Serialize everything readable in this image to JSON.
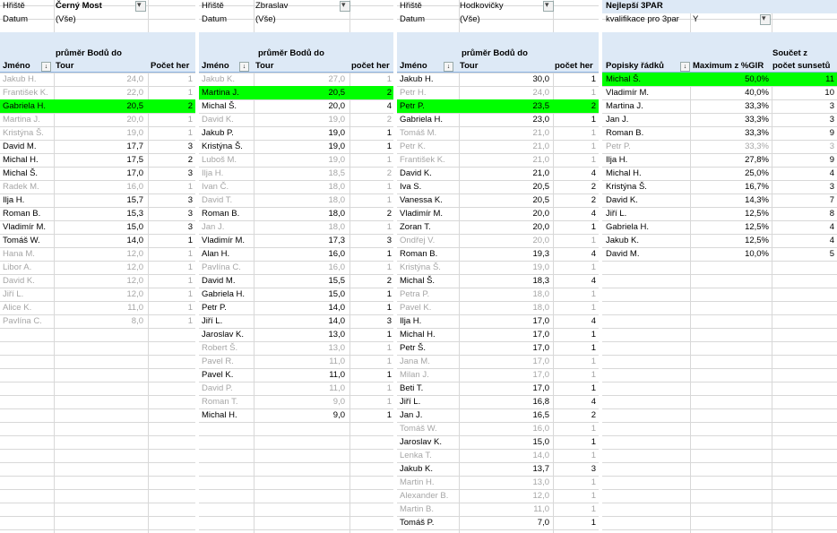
{
  "panels": [
    {
      "filter1_label": "Hřiště",
      "filter1_value": "Černý Most",
      "filter2_label": "Datum",
      "filter2_value": "(Vše)",
      "header": {
        "line1": "průměr Bodů do",
        "name": "Jméno",
        "avg": "Tour",
        "count": "Počet her"
      },
      "rows": [
        {
          "name": "Jakub H.",
          "avg": "24,0",
          "count": "1",
          "dim": true
        },
        {
          "name": "František K.",
          "avg": "22,0",
          "count": "1",
          "dim": true
        },
        {
          "name": "Gabriela H.",
          "avg": "20,5",
          "count": "2",
          "hl": true
        },
        {
          "name": "Martina J.",
          "avg": "20,0",
          "count": "1",
          "dim": true
        },
        {
          "name": "Kristýna Š.",
          "avg": "19,0",
          "count": "1",
          "dim": true
        },
        {
          "name": "David M.",
          "avg": "17,7",
          "count": "3"
        },
        {
          "name": "Michal H.",
          "avg": "17,5",
          "count": "2"
        },
        {
          "name": "Michal Š.",
          "avg": "17,0",
          "count": "3"
        },
        {
          "name": "Radek M.",
          "avg": "16,0",
          "count": "1",
          "dim": true
        },
        {
          "name": "Ilja H.",
          "avg": "15,7",
          "count": "3"
        },
        {
          "name": "Roman B.",
          "avg": "15,3",
          "count": "3"
        },
        {
          "name": "Vladimír M.",
          "avg": "15,0",
          "count": "3"
        },
        {
          "name": "Tomáš W.",
          "avg": "14,0",
          "count": "1"
        },
        {
          "name": "Hana M.",
          "avg": "12,0",
          "count": "1",
          "dim": true
        },
        {
          "name": "Libor A.",
          "avg": "12,0",
          "count": "1",
          "dim": true
        },
        {
          "name": "David K.",
          "avg": "12,0",
          "count": "1",
          "dim": true
        },
        {
          "name": "Jiří L.",
          "avg": "12,0",
          "count": "1",
          "dim": true
        },
        {
          "name": "Alice K.",
          "avg": "11,0",
          "count": "1",
          "dim": true
        },
        {
          "name": "Pavlína C.",
          "avg": "8,0",
          "count": "1",
          "dim": true
        }
      ]
    },
    {
      "filter1_label": "Hřiště",
      "filter1_value": "Zbraslav",
      "filter2_label": "Datum",
      "filter2_value": "(Vše)",
      "header": {
        "line1": "průměr Bodů do",
        "name": "Jméno",
        "avg": "Tour",
        "count": "počet her"
      },
      "rows": [
        {
          "name": "Jakub K.",
          "avg": "27,0",
          "count": "1",
          "dim": true
        },
        {
          "name": "Martina J.",
          "avg": "20,5",
          "count": "2",
          "hl": true
        },
        {
          "name": "Michal Š.",
          "avg": "20,0",
          "count": "4"
        },
        {
          "name": "David K.",
          "avg": "19,0",
          "count": "2",
          "dim": true
        },
        {
          "name": "Jakub P.",
          "avg": "19,0",
          "count": "1"
        },
        {
          "name": "Kristýna Š.",
          "avg": "19,0",
          "count": "1"
        },
        {
          "name": "Luboš M.",
          "avg": "19,0",
          "count": "1",
          "dim": true
        },
        {
          "name": "Ilja H.",
          "avg": "18,5",
          "count": "2",
          "dim": true
        },
        {
          "name": "Ivan Č.",
          "avg": "18,0",
          "count": "1",
          "dim": true
        },
        {
          "name": "David T.",
          "avg": "18,0",
          "count": "1",
          "dim": true
        },
        {
          "name": "Roman B.",
          "avg": "18,0",
          "count": "2"
        },
        {
          "name": "Jan J.",
          "avg": "18,0",
          "count": "1",
          "dim": true
        },
        {
          "name": "Vladimír M.",
          "avg": "17,3",
          "count": "3"
        },
        {
          "name": "Alan H.",
          "avg": "16,0",
          "count": "1"
        },
        {
          "name": "Pavlína C.",
          "avg": "16,0",
          "count": "1",
          "dim": true
        },
        {
          "name": "David M.",
          "avg": "15,5",
          "count": "2"
        },
        {
          "name": "Gabriela H.",
          "avg": "15,0",
          "count": "1"
        },
        {
          "name": "Petr P.",
          "avg": "14,0",
          "count": "1"
        },
        {
          "name": "Jiří L.",
          "avg": "14,0",
          "count": "3"
        },
        {
          "name": "Jaroslav K.",
          "avg": "13,0",
          "count": "1"
        },
        {
          "name": "Robert Š.",
          "avg": "13,0",
          "count": "1",
          "dim": true
        },
        {
          "name": "Pavel R.",
          "avg": "11,0",
          "count": "1",
          "dim": true
        },
        {
          "name": "Pavel K.",
          "avg": "11,0",
          "count": "1"
        },
        {
          "name": "David P.",
          "avg": "11,0",
          "count": "1",
          "dim": true
        },
        {
          "name": "Roman T.",
          "avg": "9,0",
          "count": "1",
          "dim": true
        },
        {
          "name": "Michal H.",
          "avg": "9,0",
          "count": "1"
        }
      ]
    },
    {
      "filter1_label": "Hřiště",
      "filter1_value": "Hodkovičky",
      "filter2_label": "Datum",
      "filter2_value": "(Vše)",
      "header": {
        "line1": "průměr Bodů do",
        "name": "Jméno",
        "avg": "Tour",
        "count": "počet her"
      },
      "rows": [
        {
          "name": "Jakub H.",
          "avg": "30,0",
          "count": "1"
        },
        {
          "name": "Petr H.",
          "avg": "24,0",
          "count": "1",
          "dim": true
        },
        {
          "name": "Petr P.",
          "avg": "23,5",
          "count": "2",
          "hl": true
        },
        {
          "name": "Gabriela H.",
          "avg": "23,0",
          "count": "1"
        },
        {
          "name": "Tomáš M.",
          "avg": "21,0",
          "count": "1",
          "dim": true
        },
        {
          "name": "Petr K.",
          "avg": "21,0",
          "count": "1",
          "dim": true
        },
        {
          "name": "František K.",
          "avg": "21,0",
          "count": "1",
          "dim": true
        },
        {
          "name": "David K.",
          "avg": "21,0",
          "count": "4"
        },
        {
          "name": "Iva S.",
          "avg": "20,5",
          "count": "2"
        },
        {
          "name": "Vanessa K.",
          "avg": "20,5",
          "count": "2"
        },
        {
          "name": "Vladimír M.",
          "avg": "20,0",
          "count": "4"
        },
        {
          "name": "Zoran T.",
          "avg": "20,0",
          "count": "1"
        },
        {
          "name": "Ondřej V.",
          "avg": "20,0",
          "count": "1",
          "dim": true
        },
        {
          "name": "Roman B.",
          "avg": "19,3",
          "count": "4"
        },
        {
          "name": "Kristýna Š.",
          "avg": "19,0",
          "count": "1",
          "dim": true
        },
        {
          "name": "Michal Š.",
          "avg": "18,3",
          "count": "4"
        },
        {
          "name": "Petra P.",
          "avg": "18,0",
          "count": "1",
          "dim": true
        },
        {
          "name": "Pavel K.",
          "avg": "18,0",
          "count": "1",
          "dim": true
        },
        {
          "name": "Ilja H.",
          "avg": "17,0",
          "count": "4"
        },
        {
          "name": "Michal H.",
          "avg": "17,0",
          "count": "1"
        },
        {
          "name": "Petr Š.",
          "avg": "17,0",
          "count": "1"
        },
        {
          "name": "Jana M.",
          "avg": "17,0",
          "count": "1",
          "dim": true
        },
        {
          "name": "Milan J.",
          "avg": "17,0",
          "count": "1",
          "dim": true
        },
        {
          "name": "Beti T.",
          "avg": "17,0",
          "count": "1"
        },
        {
          "name": "Jiří L.",
          "avg": "16,8",
          "count": "4"
        },
        {
          "name": "Jan J.",
          "avg": "16,5",
          "count": "2"
        },
        {
          "name": "Tomáš W.",
          "avg": "16,0",
          "count": "1",
          "dim": true
        },
        {
          "name": "Jaroslav K.",
          "avg": "15,0",
          "count": "1"
        },
        {
          "name": "Lenka T.",
          "avg": "14,0",
          "count": "1",
          "dim": true
        },
        {
          "name": "Jakub K.",
          "avg": "13,7",
          "count": "3"
        },
        {
          "name": "Martin H.",
          "avg": "13,0",
          "count": "1",
          "dim": true
        },
        {
          "name": "Alexander B.",
          "avg": "12,0",
          "count": "1",
          "dim": true
        },
        {
          "name": "Martin B.",
          "avg": "11,0",
          "count": "1",
          "dim": true
        },
        {
          "name": "Tomáš P.",
          "avg": "7,0",
          "count": "1"
        }
      ]
    }
  ],
  "panel4": {
    "title": "Nejlepší 3PAR",
    "filter_label": "kvalifikace pro 3par",
    "filter_value": "Y",
    "header": {
      "col1": "Popisky řádků",
      "col2": "Maximum z %GIR",
      "col3_line1": "Součet z",
      "col3_line2": "počet sunsetů"
    },
    "rows": [
      {
        "name": "Michal Š.",
        "pct": "50,0%",
        "sum": "11",
        "hl": true
      },
      {
        "name": "Vladimír M.",
        "pct": "40,0%",
        "sum": "10"
      },
      {
        "name": "Martina J.",
        "pct": "33,3%",
        "sum": "3"
      },
      {
        "name": "Jan J.",
        "pct": "33,3%",
        "sum": "3"
      },
      {
        "name": "Roman B.",
        "pct": "33,3%",
        "sum": "9"
      },
      {
        "name": "Petr P.",
        "pct": "33,3%",
        "sum": "3",
        "dim": true
      },
      {
        "name": "Ilja H.",
        "pct": "27,8%",
        "sum": "9"
      },
      {
        "name": "Michal H.",
        "pct": "25,0%",
        "sum": "4"
      },
      {
        "name": "Kristýna Š.",
        "pct": "16,7%",
        "sum": "3"
      },
      {
        "name": "David K.",
        "pct": "14,3%",
        "sum": "7"
      },
      {
        "name": "Jiří L.",
        "pct": "12,5%",
        "sum": "8"
      },
      {
        "name": "Gabriela H.",
        "pct": "12,5%",
        "sum": "4"
      },
      {
        "name": "Jakub K.",
        "pct": "12,5%",
        "sum": "4"
      },
      {
        "name": "David M.",
        "pct": "10,0%",
        "sum": "5"
      }
    ]
  },
  "colors": {
    "highlight": "#00ff00",
    "header_bg": "#dde9f6",
    "dim_text": "#a6a6a6"
  }
}
